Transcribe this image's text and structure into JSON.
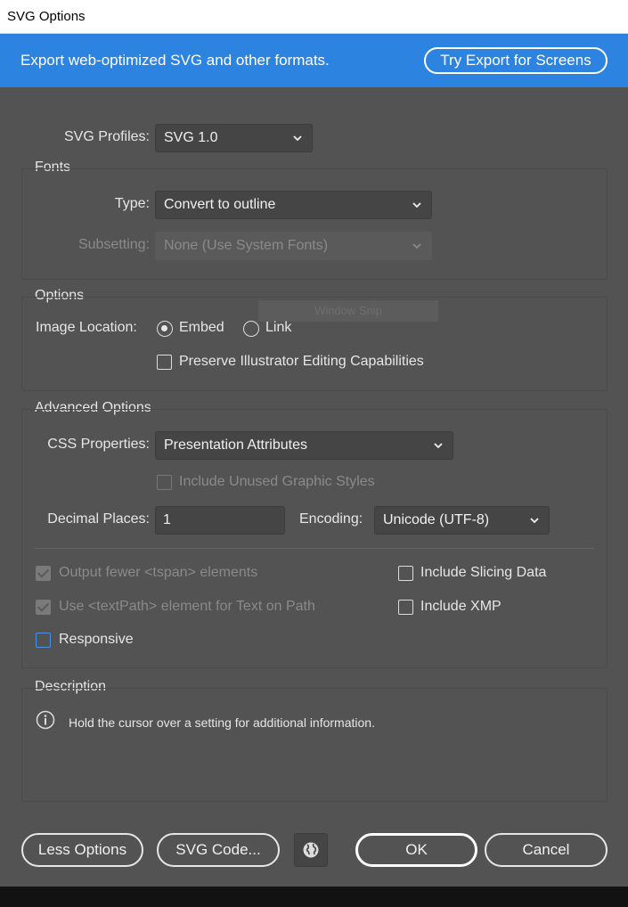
{
  "window": {
    "title": "SVG Options"
  },
  "banner": {
    "text": "Export web-optimized SVG and other formats.",
    "try_button": "Try Export for Screens",
    "color": "#2c83e0"
  },
  "profiles": {
    "label": "SVG Profiles:",
    "value": "SVG 1.0"
  },
  "fonts": {
    "section": "Fonts",
    "type_label": "Type:",
    "type_value": "Convert to outline",
    "subsetting_label": "Subsetting:",
    "subsetting_value": "None (Use System Fonts)"
  },
  "options": {
    "section": "Options",
    "image_location_label": "Image Location:",
    "embed_label": "Embed",
    "embed_selected": true,
    "link_label": "Link",
    "preserve_label": "Preserve Illustrator Editing Capabilities",
    "ghost_text": "Window Snip"
  },
  "advanced": {
    "section": "Advanced Options",
    "css_label": "CSS Properties:",
    "css_value": "Presentation Attributes",
    "unused_styles_label": "Include Unused Graphic Styles",
    "decimal_label": "Decimal Places:",
    "decimal_value": "1",
    "encoding_label": "Encoding:",
    "encoding_value": "Unicode (UTF-8)",
    "tspan_label": "Output fewer <tspan> elements",
    "textpath_label": "Use <textPath> element for Text on Path",
    "slicing_label": "Include Slicing Data",
    "xmp_label": "Include XMP",
    "responsive_label": "Responsive"
  },
  "description": {
    "section": "Description",
    "text": "Hold the cursor over a setting for additional information.",
    "icon": "info-icon"
  },
  "footer": {
    "less_options": "Less Options",
    "svg_code": "SVG Code...",
    "globe_icon": "globe-icon",
    "ok": "OK",
    "cancel": "Cancel"
  }
}
